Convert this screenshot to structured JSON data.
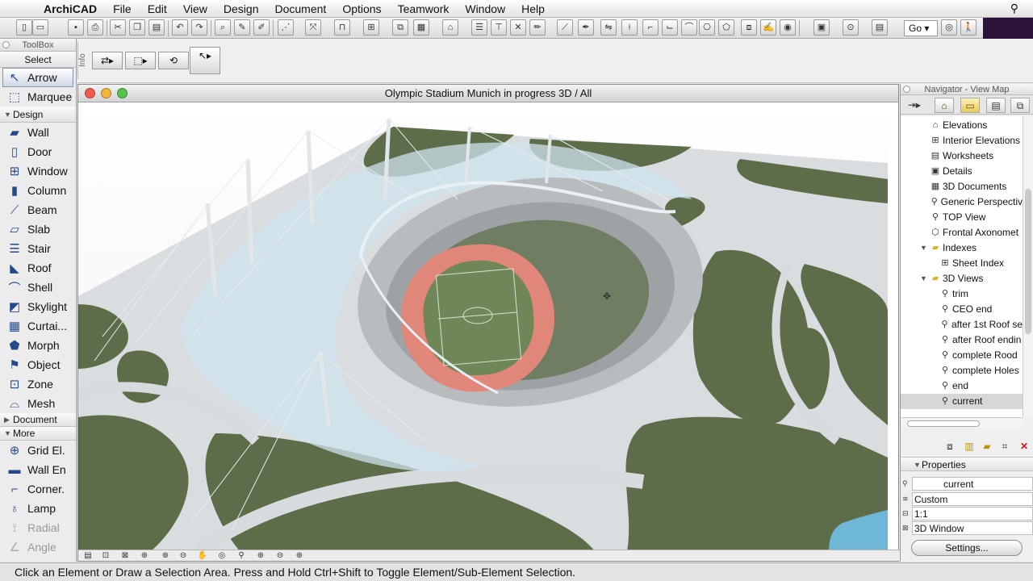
{
  "menubar": {
    "app": "ArchiCAD",
    "items": [
      "File",
      "Edit",
      "View",
      "Design",
      "Document",
      "Options",
      "Teamwork",
      "Window",
      "Help"
    ]
  },
  "toolbar": {
    "go_label": "Go"
  },
  "toolbox": {
    "title": "ToolBox",
    "select_header": "Select",
    "select_tools": [
      "Arrow",
      "Marquee"
    ],
    "design_header": "Design",
    "design_tools": [
      "Wall",
      "Door",
      "Window",
      "Column",
      "Beam",
      "Slab",
      "Stair",
      "Roof",
      "Shell",
      "Skylight",
      "Curtai...",
      "Morph",
      "Object",
      "Zone",
      "Mesh"
    ],
    "document_header": "Document",
    "more_header": "More",
    "more_tools": [
      "Grid El.",
      "Wall En",
      "Corner.",
      "Lamp",
      "Radial",
      "Angle"
    ]
  },
  "infobox": {
    "label": "Info"
  },
  "window3d": {
    "title": "Olympic Stadium Munich in progress 3D / All"
  },
  "navigator": {
    "title": "Navigator - View Map",
    "items": [
      {
        "label": "Elevations",
        "level": 1
      },
      {
        "label": "Interior Elevations",
        "level": 1
      },
      {
        "label": "Worksheets",
        "level": 1
      },
      {
        "label": "Details",
        "level": 1
      },
      {
        "label": "3D Documents",
        "level": 1
      },
      {
        "label": "Generic Perspectiv",
        "level": 1
      },
      {
        "label": "TOP View",
        "level": 1
      },
      {
        "label": "Frontal Axonomet",
        "level": 1
      },
      {
        "label": "Indexes",
        "level": 1
      },
      {
        "label": "Sheet Index",
        "level": 2
      },
      {
        "label": "3D Views",
        "level": 1
      },
      {
        "label": "trim",
        "level": 2
      },
      {
        "label": "CEO end",
        "level": 2
      },
      {
        "label": "after 1st Roof se",
        "level": 2
      },
      {
        "label": "after Roof endin",
        "level": 2
      },
      {
        "label": "complete Rood",
        "level": 2
      },
      {
        "label": "complete Holes",
        "level": 2
      },
      {
        "label": "end",
        "level": 2
      },
      {
        "label": "current",
        "level": 2
      }
    ],
    "properties_header": "Properties",
    "prop_name": "current",
    "prop_scale_type": "Custom",
    "prop_scale": "1:1",
    "prop_type": "3D Window",
    "settings_label": "Settings..."
  },
  "status": {
    "text": "Click an Element or Draw a Selection Area. Press and Hold Ctrl+Shift to Toggle Element/Sub-Element Selection."
  },
  "colors": {
    "grass": "#5d6d4a",
    "track": "#e0877a",
    "pitch": "#6f8758",
    "pavement": "#d9dcdf",
    "tent_glass": "#cfe3ee"
  }
}
